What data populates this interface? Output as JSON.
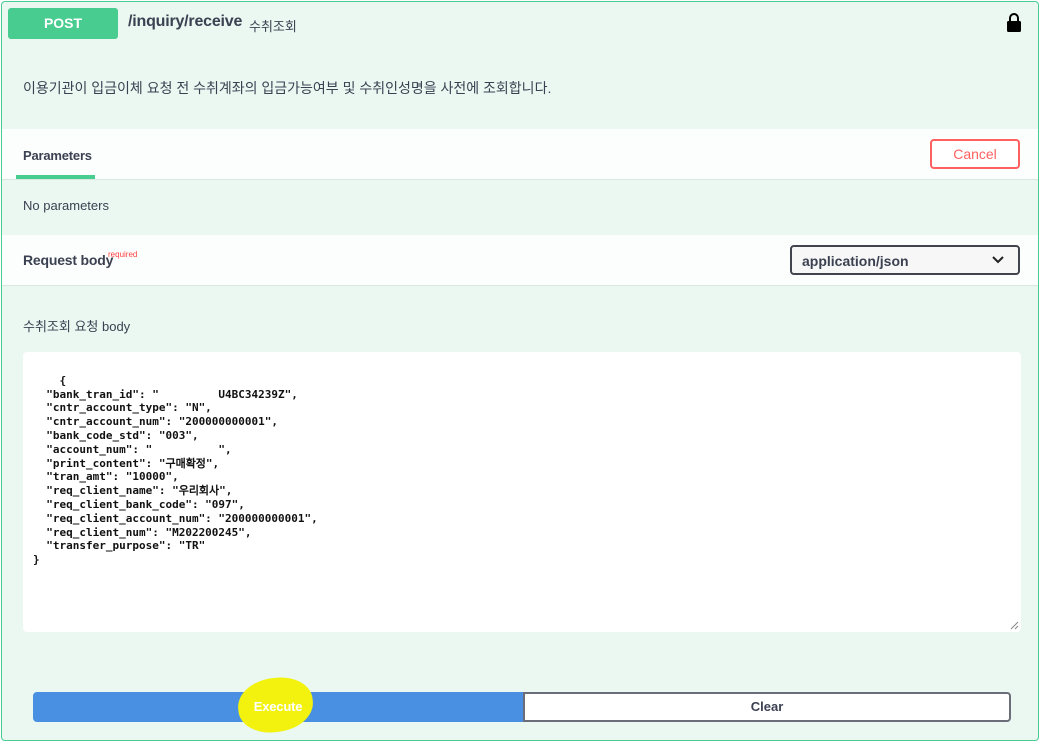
{
  "operation": {
    "method": "POST",
    "path": "/inquiry/receive",
    "summary": "수취조회",
    "description": "이용기관이 입금이체 요청 전 수취계좌의 입금가능여부 및 수취인성명을 사전에 조회합니다."
  },
  "parameters": {
    "tab_label": "Parameters",
    "cancel_label": "Cancel",
    "empty_text": "No parameters"
  },
  "request_body": {
    "label": "Request body",
    "required_label": "required",
    "content_type": "application/json",
    "description": "수취조회 요청 body",
    "json_text": "{\n  \"bank_tran_id\": \"         U4BC34239Z\",\n  \"cntr_account_type\": \"N\",\n  \"cntr_account_num\": \"200000000001\",\n  \"bank_code_std\": \"003\",\n  \"account_num\": \"          \",\n  \"print_content\": \"구매확정\",\n  \"tran_amt\": \"10000\",\n  \"req_client_name\": \"우리회사\",\n  \"req_client_bank_code\": \"097\",\n  \"req_client_account_num\": \"200000000001\",\n  \"req_client_num\": \"M202200245\",\n  \"transfer_purpose\": \"TR\"\n}"
  },
  "actions": {
    "execute_label": "Execute",
    "clear_label": "Clear"
  },
  "colors": {
    "method_post": "#49cc90",
    "execute": "#4990e2",
    "cancel": "#ff6060",
    "highlight": "#f2f20e"
  },
  "icons": {
    "lock": "lock-icon",
    "chevron": "chevron-down-icon"
  }
}
